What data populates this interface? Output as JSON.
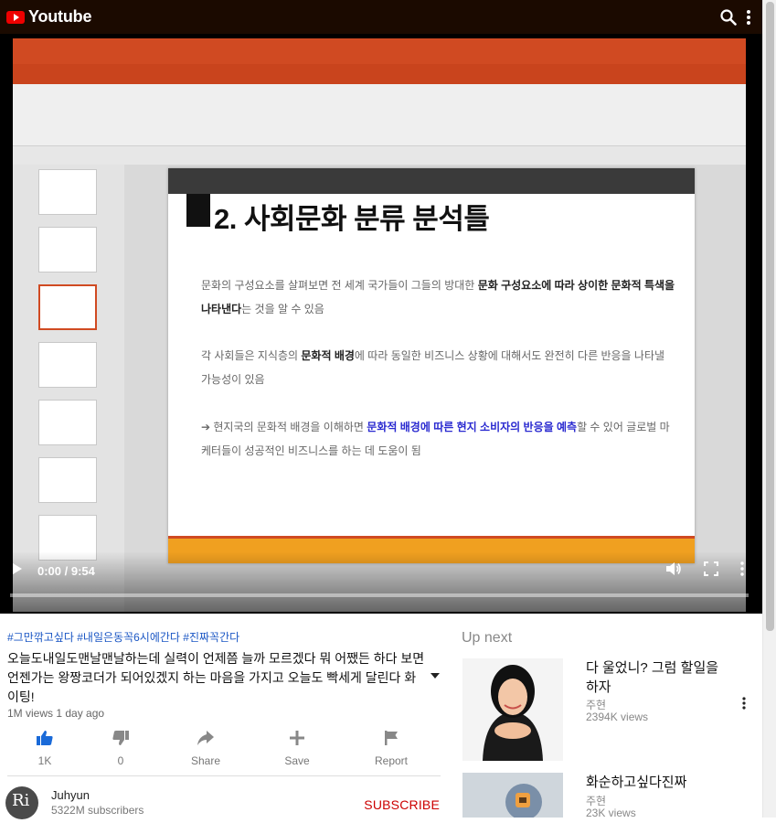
{
  "header": {
    "app_name": "Youtube"
  },
  "player": {
    "time": "0:00 / 9:54",
    "progress": 0,
    "slide": {
      "title": "2. 사회문화 분류 분석틀",
      "para1_a": "문화의 구성요소를 살펴보면 전 세계 국가들이 그들의 방대한 ",
      "para1_b": "문화 구성요소에 따라 상이한 문화적 특색을 나타낸다",
      "para1_c": "는 것을 알 수 있음",
      "para2_a": "각 사회들은 지식층의 ",
      "para2_b": "문화적 배경",
      "para2_c": "에 따라 동일한 비즈니스 상황에 대해서도 완전히 다른 반응을 나타낼 가능성이 있음",
      "para3_a": "➔ 현지국의 문화적 배경을 이해하면 ",
      "para3_b": "문화적 배경에 따른 현지 소비자의 반응을 예측",
      "para3_c": "할 수 있어 글로벌 마케터들이 성공적인 비즈니스를 하는 데 도움이 됨"
    }
  },
  "video": {
    "hashtags": "#그만깎고싶다 #내일은동꼭6시에간다 #진짜꼭간다",
    "title": "오늘도내일도맨날맨날하는데 실력이 언제쯤 늘까 모르겠다 뭐 어쨌든 하다 보면 언젠가는 왕짱코더가 되어있겠지 하는 마음을 가지고 오늘도 빡세게 달린다 화이팅!",
    "meta": "1M views 1 day ago",
    "actions": {
      "like_count": "1K",
      "dislike_count": "0",
      "share_label": "Share",
      "save_label": "Save",
      "report_label": "Report"
    }
  },
  "channel": {
    "avatar_text": "Ri",
    "name": "Juhyun",
    "subscribers": "5322M subscribers",
    "subscribe_label": "SUBSCRIBE"
  },
  "up_next": {
    "heading": "Up next",
    "items": [
      {
        "title": "다 울었니? 그럼 할일을 하자",
        "author": "주현",
        "views": "2394K views"
      },
      {
        "title": "화순하고싶다진짜",
        "author": "주현",
        "views": "23K views"
      }
    ]
  },
  "colors": {
    "accent": "#cc0000",
    "link": "#1a56c4",
    "like_active": "#1a6ad8",
    "topbar": "#1b0a00"
  }
}
